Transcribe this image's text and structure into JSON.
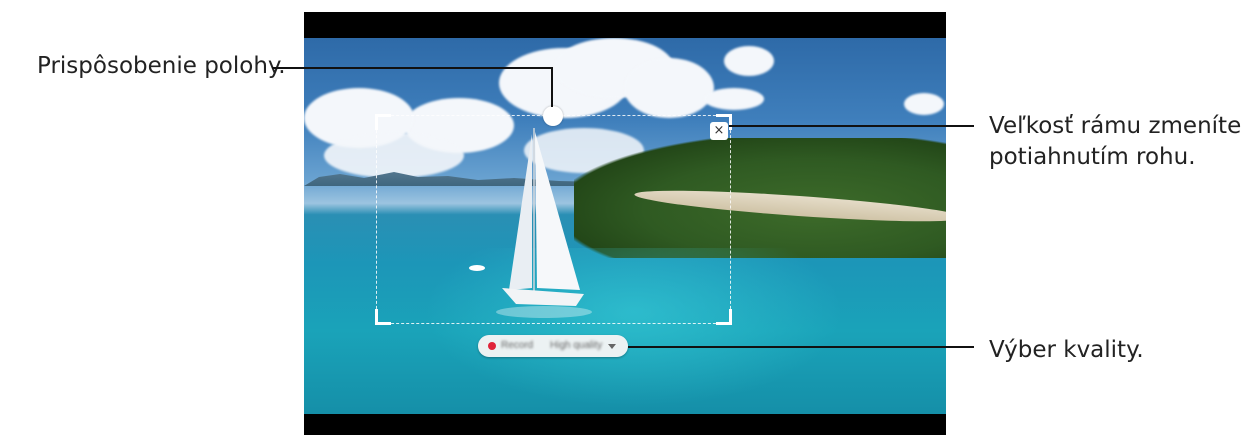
{
  "callouts": {
    "position": "Prispôsobenie polohy.",
    "resize_line1": "Veľkosť rámu zmeníte",
    "resize_line2": "potiahnutím rohu.",
    "quality": "Výber kvality."
  },
  "record_bar": {
    "record_label": "Record",
    "quality_value": "High quality"
  },
  "crop_frame": {
    "close_glyph": "×"
  },
  "icons": {
    "close": "close-icon",
    "record": "record-dot-icon",
    "quality_dropdown": "chevron-down-icon",
    "position_handle": "drag-handle"
  },
  "colors": {
    "record_dot": "#e0243a",
    "callout_text": "#222222"
  }
}
